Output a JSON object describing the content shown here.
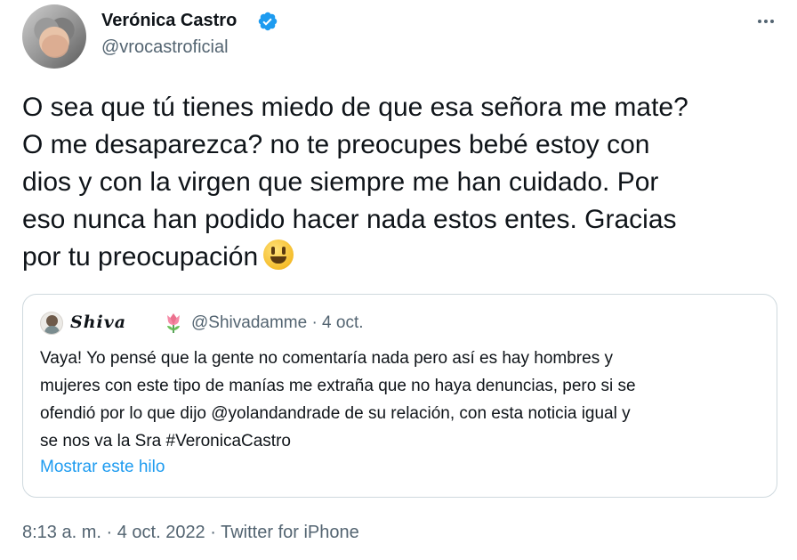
{
  "author": {
    "display_name": "Verónica Castro",
    "handle": "@vrocastroficial"
  },
  "icons": {
    "verified": "verified-badge-icon",
    "more": "more-options-icon",
    "emoji": "grinning-face-emoji",
    "tulip": "tulip-emoji"
  },
  "tweet": {
    "lines": [
      "O sea que tú tienes miedo de que esa señora me mate?",
      "O me desaparezca? no te preocupes bebé estoy con",
      "dios y con la virgen que siempre me han cuidado. Por",
      "eso nunca han podido hacer nada estos entes. Gracias",
      "por tu preocupación"
    ]
  },
  "quote": {
    "name": "𝑺𝒉𝒊𝒗𝒂",
    "handle_date": "@Shivadamme · 4 oct.",
    "lines": [
      "Vaya! Yo pensé que la gente no comentaría nada pero así es hay hombres y",
      "mujeres con este tipo de manías me extraña que no haya denuncias, pero si se",
      "ofendió por lo que dijo @yolandandrade de su relación, con esta noticia igual y",
      "se nos va la Sra #VeronicaCastro"
    ],
    "show_thread": "Mostrar este hilo"
  },
  "meta": {
    "time": "8:13 a. m.",
    "sep1": " · ",
    "date": "4 oct. 2022",
    "sep2": " · ",
    "source": "Twitter for iPhone"
  },
  "colors": {
    "accent": "#1d9bf0",
    "secondary_text": "#536471",
    "border": "#cfd9de"
  }
}
